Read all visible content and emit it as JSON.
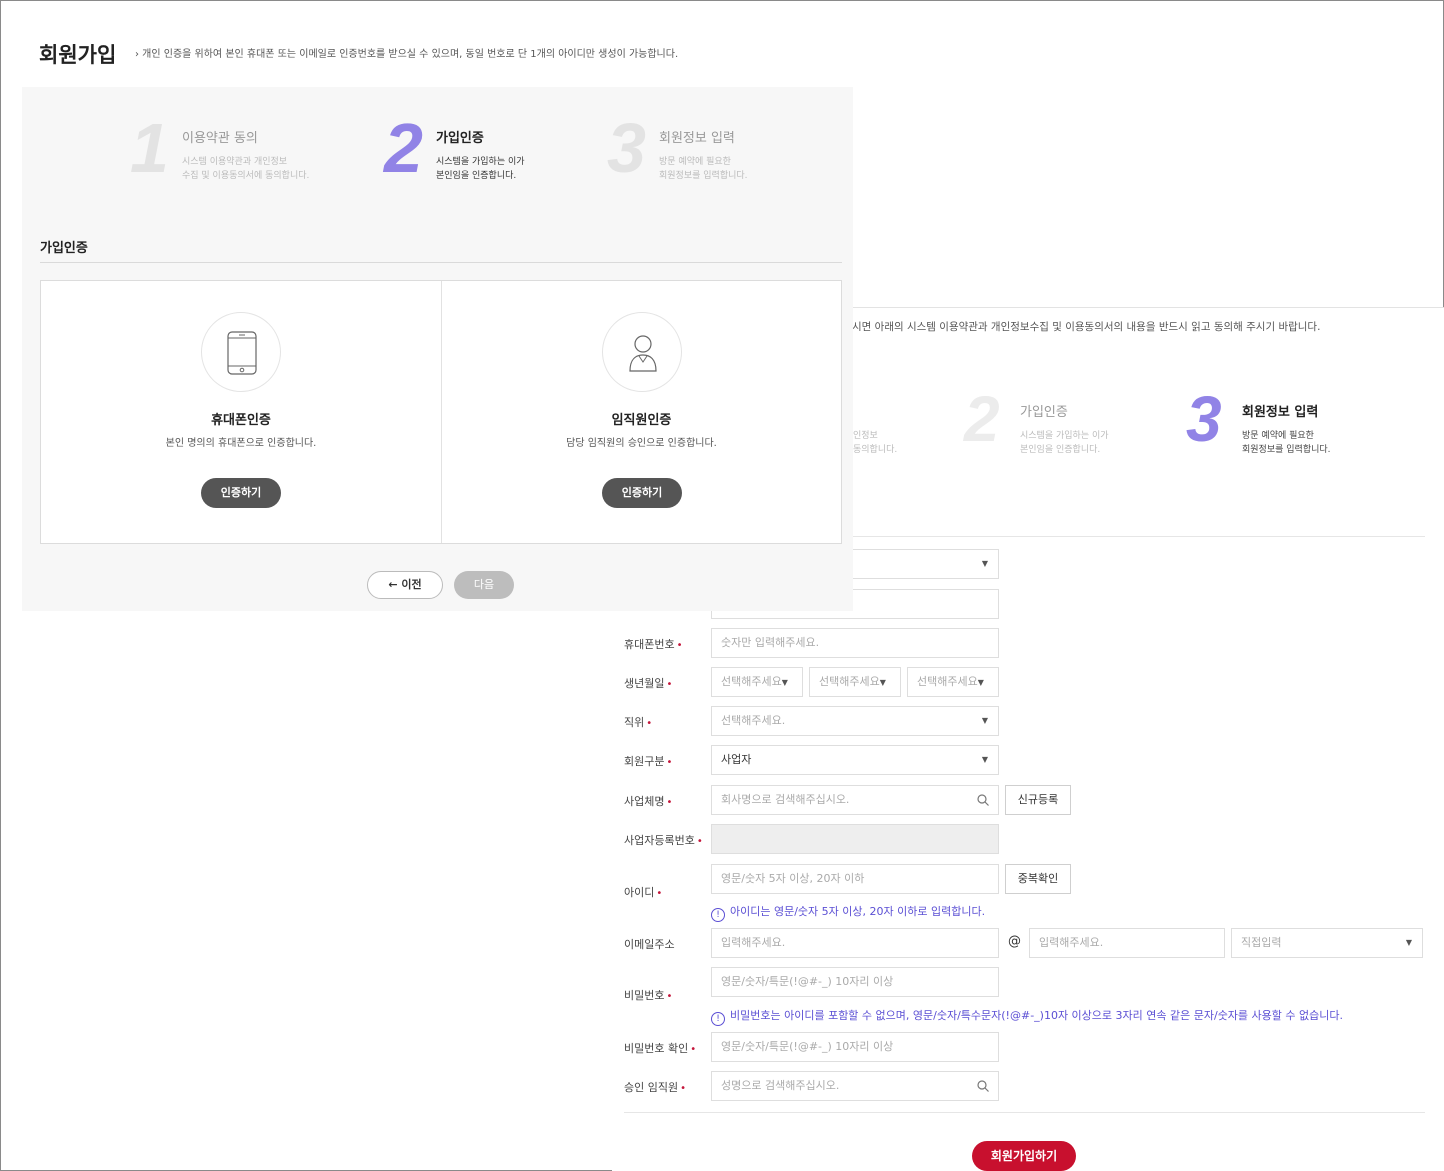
{
  "page": {
    "title": "회원가입",
    "description": "› 개인 인증을 위하여 본인 휴대폰 또는 이메일로 인증번호를 받으실 수 있으며, 동일 번호로 단 1개의 아이디만 생성이 가능합니다."
  },
  "front": {
    "steps": [
      {
        "num": "1",
        "title": "이용약관 동의",
        "desc1": "시스템 이용약관과 개인정보",
        "desc2": "수집 및 이용동의서에 동의합니다."
      },
      {
        "num": "2",
        "title": "가입인증",
        "desc1": "시스템을 가입하는 이가",
        "desc2": "본인임을 인증합니다."
      },
      {
        "num": "3",
        "title": "회원정보 입력",
        "desc1": "방문 예약에 필요한",
        "desc2": "회원정보를 입력합니다."
      }
    ],
    "section_title": "가입인증",
    "cards": [
      {
        "title": "휴대폰인증",
        "desc": "본인 명의의 휴대폰으로 인증합니다.",
        "button": "인증하기",
        "icon": "mobile-phone-icon"
      },
      {
        "title": "임직원인증",
        "desc": "담당 임직원의 승인으로 인증합니다.",
        "button": "인증하기",
        "icon": "person-icon"
      }
    ],
    "prev_label": "← 이전",
    "next_label": "다음"
  },
  "back": {
    "notice": "시면 아래의 시스템 이용약관과 개인정보수집 및 이용동의서의 내용을 반드시 읽고 동의해 주시기 바랍니다.",
    "step_fragment1": "인정보",
    "step_fragment2": "동의합니다.",
    "steps": [
      {
        "num": "2",
        "title": "가입인증",
        "desc1": "시스템을 가입하는 이가",
        "desc2": "본인임을 인증합니다."
      },
      {
        "num": "3",
        "title": "회원정보 입력",
        "desc1": "방문 예약에 필요한",
        "desc2": "회원정보를 입력합니다."
      }
    ],
    "form": {
      "phone": {
        "label": "휴대폰번호",
        "placeholder": "숫자만 입력해주세요."
      },
      "birth": {
        "label": "생년월일",
        "year": "선택해주세요",
        "month": "선택해주세요",
        "day": "선택해주세요"
      },
      "position": {
        "label": "직위",
        "placeholder": "선택해주세요."
      },
      "member_type": {
        "label": "회원구분",
        "value": "사업자"
      },
      "company": {
        "label": "사업체명",
        "placeholder": "회사명으로 검색해주십시오.",
        "button": "신규등록"
      },
      "biz_no": {
        "label": "사업자등록번호"
      },
      "user_id": {
        "label": "아이디",
        "placeholder": "영문/숫자 5자 이상, 20자 이하",
        "button": "중복확인",
        "hint": "아이디는 영문/숫자 5자 이상, 20자 이하로 입력합니다."
      },
      "email": {
        "label": "이메일주소",
        "local_placeholder": "입력해주세요.",
        "at": "@",
        "domain_placeholder": "입력해주세요.",
        "select_value": "직접입력"
      },
      "password": {
        "label": "비밀번호",
        "placeholder": "영문/숫자/특문(!@#-_) 10자리 이상",
        "hint": "비밀번호는 아이디를 포함할 수 없으며, 영문/숫자/특수문자(!@#-_)10자 이상으로 3자리 연속 같은 문자/숫자를 사용할 수 없습니다."
      },
      "password_confirm": {
        "label": "비밀번호 확인",
        "placeholder": "영문/숫자/특문(!@#-_) 10자리 이상"
      },
      "approver": {
        "label": "승인 임직원",
        "placeholder": "성명으로 검색해주십시오."
      },
      "required_mark": "•",
      "submit": "회원가입하기"
    }
  },
  "colors": {
    "accent_purple": "#9183e6",
    "hint_blue": "#5b4fd4",
    "submit_red": "#c8102e",
    "required_red": "#c4163b"
  }
}
